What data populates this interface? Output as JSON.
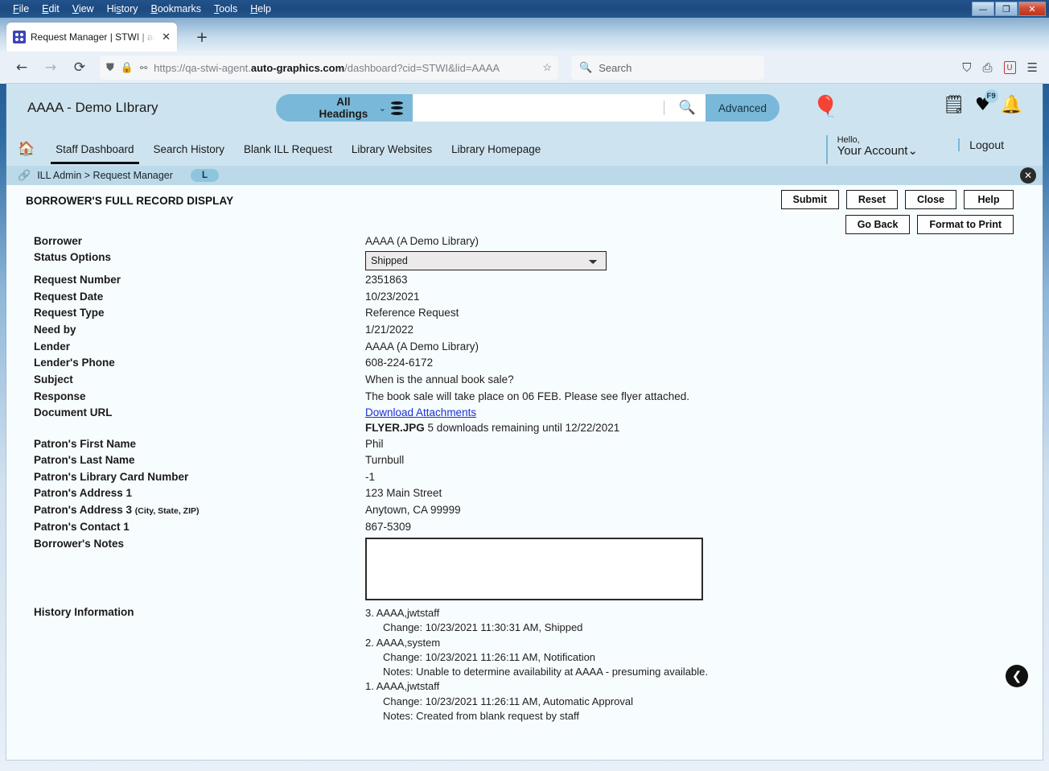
{
  "browser": {
    "menu": [
      "File",
      "Edit",
      "View",
      "History",
      "Bookmarks",
      "Tools",
      "Help"
    ],
    "window_controls": {
      "minimize": "—",
      "maximize": "❐",
      "close": "✕"
    },
    "tab": {
      "title": "Request Manager | STWI | aaaa",
      "close": "✕"
    },
    "newtab_label": "+",
    "url": {
      "prefix": "https://qa-stwi-agent.",
      "domain": "auto-graphics.com",
      "suffix": "/dashboard?cid=STWI&lid=AAAA"
    },
    "search_placeholder": "Search"
  },
  "app": {
    "library_title": "AAAA - Demo LIbrary",
    "search": {
      "scope": "All Headings",
      "query": "",
      "advanced_label": "Advanced"
    },
    "nav": [
      {
        "label": "Staff Dashboard",
        "active": true
      },
      {
        "label": "Search History",
        "active": false
      },
      {
        "label": "Blank ILL Request",
        "active": false
      },
      {
        "label": "Library Websites",
        "active": false
      },
      {
        "label": "Library Homepage",
        "active": false
      }
    ],
    "account": {
      "greeting": "Hello,",
      "name": "Your Account⌄"
    },
    "logout": "Logout",
    "favorites_badge": "F9",
    "breadcrumb": {
      "text": "ILL Admin > Request Manager",
      "pill": "L"
    }
  },
  "record": {
    "title": "BORROWER'S FULL RECORD DISPLAY",
    "buttons_row1": [
      "Submit",
      "Reset",
      "Close",
      "Help"
    ],
    "buttons_row2": [
      "Go Back",
      "Format to Print"
    ],
    "fields": [
      {
        "label": "Borrower",
        "value": "AAAA (A Demo Library)"
      },
      {
        "label": "Status Options",
        "value": "Shipped",
        "type": "select"
      },
      {
        "label": "Request Number",
        "value": "2351863"
      },
      {
        "label": "Request Date",
        "value": "10/23/2021"
      },
      {
        "label": "Request Type",
        "value": "Reference Request"
      },
      {
        "label": "Need by",
        "value": "1/21/2022"
      },
      {
        "label": "Lender",
        "value": "AAAA (A Demo Library)"
      },
      {
        "label": "Lender's Phone",
        "value": "608-224-6172"
      },
      {
        "label": "Subject",
        "value": "When is the annual book sale?"
      },
      {
        "label": "Response",
        "value": "The book sale will take place on 06 FEB. Please see flyer attached."
      }
    ],
    "document_url": {
      "label": "Document URL",
      "link": "Download Attachments",
      "file_name": "FLYER.JPG",
      "file_note": "5 downloads remaining until 12/22/2021"
    },
    "patron": [
      {
        "label": "Patron's First Name",
        "value": "Phil"
      },
      {
        "label": "Patron's Last Name",
        "value": "Turnbull"
      },
      {
        "label": "Patron's Library Card Number",
        "value": "-1"
      },
      {
        "label": "Patron's Address 1",
        "value": "123 Main Street"
      },
      {
        "label": "Patron's Address 3",
        "sublabel": "(City, State, ZIP)",
        "value": "Anytown, CA 99999"
      },
      {
        "label": "Patron's Contact 1",
        "value": "867-5309"
      }
    ],
    "notes": {
      "label": "Borrower's Notes",
      "value": ""
    },
    "history": {
      "label": "History Information",
      "entries": [
        {
          "head": "3. AAAA,jwtstaff",
          "lines": [
            "Change: 10/23/2021 11:30:31 AM, Shipped"
          ]
        },
        {
          "head": "2. AAAA,system",
          "lines": [
            "Change: 10/23/2021 11:26:11 AM, Notification",
            "Notes: Unable to determine availability at AAAA - presuming available."
          ]
        },
        {
          "head": "1. AAAA,jwtstaff",
          "lines": [
            "Change: 10/23/2021 11:26:11 AM, Automatic Approval",
            "Notes: Created from blank request by staff"
          ]
        }
      ]
    }
  },
  "colors": {
    "app_header": "#cde4f0",
    "accent": "#7ab8d9",
    "link": "#1a31d6",
    "page_bg": "#f7fcfe"
  }
}
